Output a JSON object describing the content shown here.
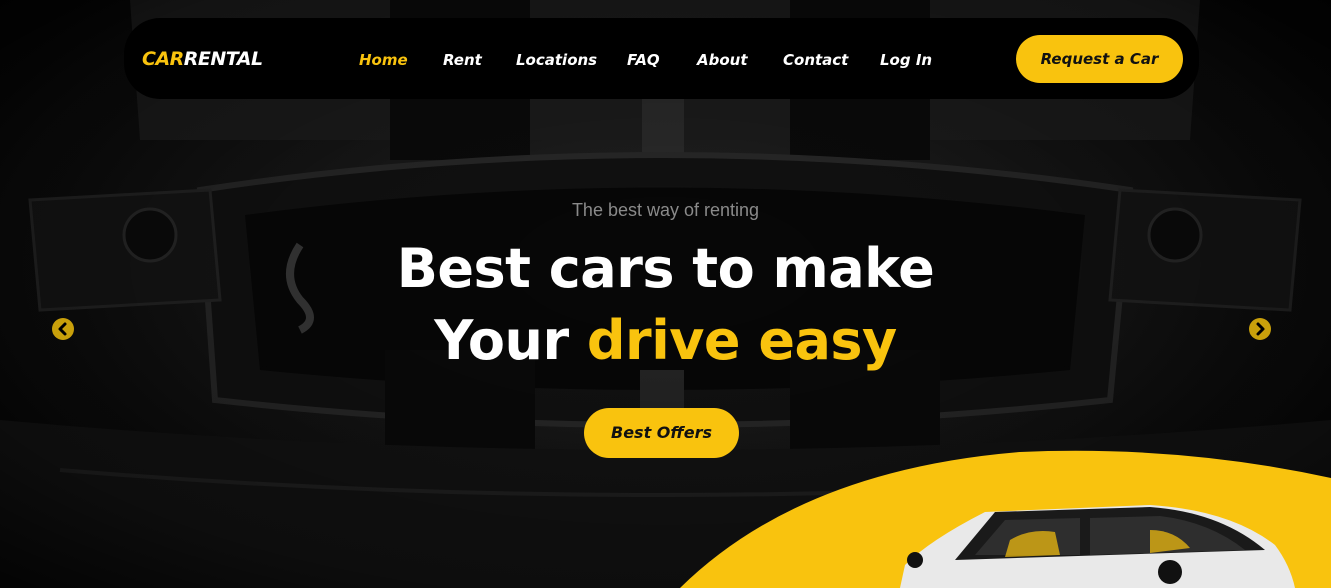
{
  "brand": {
    "logo_part1": "CAR",
    "logo_part2": "RENTAL",
    "accent_color": "#f9c30e"
  },
  "nav": {
    "items": [
      {
        "label": "Home",
        "active": true
      },
      {
        "label": "Rent",
        "active": false
      },
      {
        "label": "Locations",
        "active": false
      },
      {
        "label": "FAQ",
        "active": false
      },
      {
        "label": "About",
        "active": false
      },
      {
        "label": "Contact",
        "active": false
      },
      {
        "label": "Log In",
        "active": false
      }
    ],
    "cta_label": "Request a Car"
  },
  "hero": {
    "subtitle": "The best way of renting",
    "headline_line1": "Best cars to make",
    "headline_line2_prefix": "Your",
    "headline_line2_highlight": "drive easy",
    "button_label": "Best Offers"
  },
  "slider": {
    "prev_icon": "chevron-left-icon",
    "next_icon": "chevron-right-icon"
  }
}
